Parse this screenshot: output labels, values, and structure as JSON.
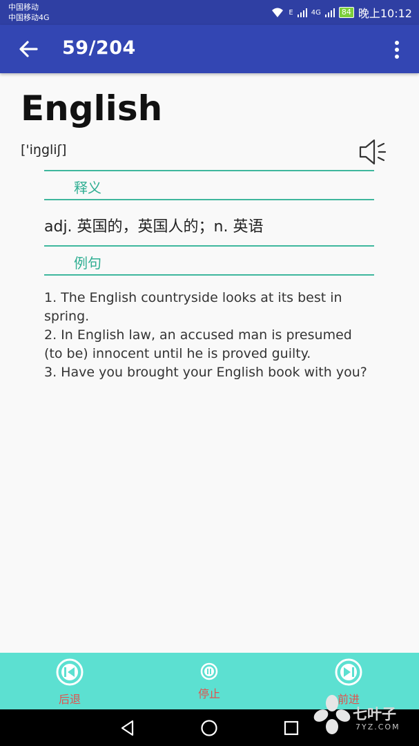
{
  "status_bar": {
    "carrier_1": "中国移动",
    "carrier_2": "中国移动4G",
    "signal_1": "E",
    "signal_2": "4G",
    "battery": "84",
    "time": "晚上10:12"
  },
  "app_bar": {
    "page_counter": "59/204"
  },
  "entry": {
    "word": "English",
    "phonetic": "['iŋgliʃ]",
    "definition_header": "释义",
    "definition": "adj. 英国的，英国人的；n. 英语",
    "examples_header": "例句",
    "examples": [
      "1. The English countryside looks at its best in spring.",
      "2. In English law, an accused man is presumed (to be) innocent until he is proved guilty.",
      "3. Have you brought your English book with you?"
    ]
  },
  "controls": {
    "previous_label": "后退",
    "stop_label": "停止",
    "next_label": "前进"
  },
  "watermark": {
    "brand": "七叶子",
    "domain": "7YZ.COM"
  },
  "colors": {
    "app_bar": "#3346b3",
    "accent": "#3eb79d",
    "control_bar": "#5ce0d1",
    "control_label": "#e2514d"
  }
}
